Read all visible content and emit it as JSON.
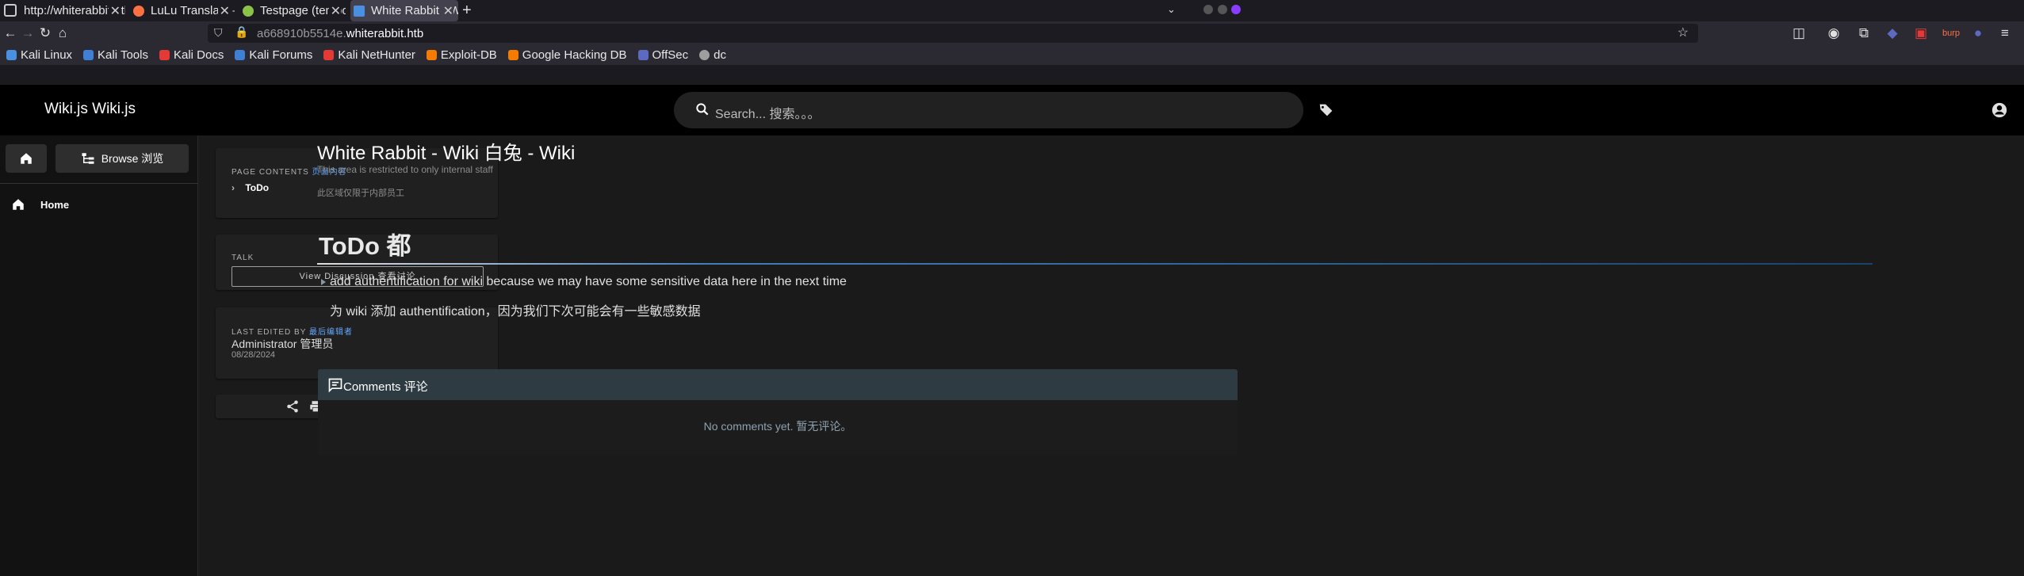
{
  "browser": {
    "tabs": [
      {
        "label": "http://whiterabbit.htb/#servi",
        "fav_color": "#888888"
      },
      {
        "label": "LuLu Translate – Get this",
        "fav_color": "#ff7043"
      },
      {
        "label": "Testpage (temporary)",
        "fav_color": "#8bc34a"
      },
      {
        "label": "White Rabbit - Wiki | Wiki",
        "fav_color": "#4a90e2"
      }
    ],
    "new_tab": "+",
    "url_dim": "a668910b5514e.",
    "url_host": "whiterabbit.htb",
    "bookmarks": [
      {
        "label": "Kali Linux",
        "color": "#4a90e2"
      },
      {
        "label": "Kali Tools",
        "color": "#3f7fd6"
      },
      {
        "label": "Kali Docs",
        "color": "#e53935"
      },
      {
        "label": "Kali Forums",
        "color": "#3f7fd6"
      },
      {
        "label": "Kali NetHunter",
        "color": "#e53935"
      },
      {
        "label": "Exploit-DB",
        "color": "#f57c00"
      },
      {
        "label": "Google Hacking DB",
        "color": "#f57c00"
      },
      {
        "label": "OffSec",
        "color": "#5c6bc0"
      },
      {
        "label": "dc",
        "color": "#9e9e9e"
      }
    ]
  },
  "header": {
    "brand": "Wiki.js Wiki.js",
    "search_placeholder": "Search... 搜索。。。"
  },
  "sidebar": {
    "browse_label": "Browse 浏览",
    "home_label": "Home"
  },
  "toc": {
    "title": "PAGE CONTENTS",
    "title_cn": "页面内容",
    "items": [
      {
        "label": "ToDo"
      }
    ]
  },
  "talk": {
    "title": "TALK",
    "button": "View Discussion 查看讨论"
  },
  "last_edited": {
    "title": "LAST EDITED BY",
    "title_cn": "最后编辑者",
    "author": "Administrator 管理员",
    "date": "08/28/2024"
  },
  "page": {
    "title": "White Rabbit - Wiki 白兔 - Wiki",
    "subtitle": "This area is restricted to only internal staff",
    "subtitle_cn": "此区域仅限于内部员工",
    "heading": "ToDo 都",
    "item_en": "add authentification for wiki because we may have some sensitive data here in the next time",
    "item_cn": "为 wiki 添加 authentification，因为我们下次可能会有一些敏感数据"
  },
  "comments": {
    "title": "Comments 评论",
    "empty": "No comments yet. 暂无评论。"
  }
}
